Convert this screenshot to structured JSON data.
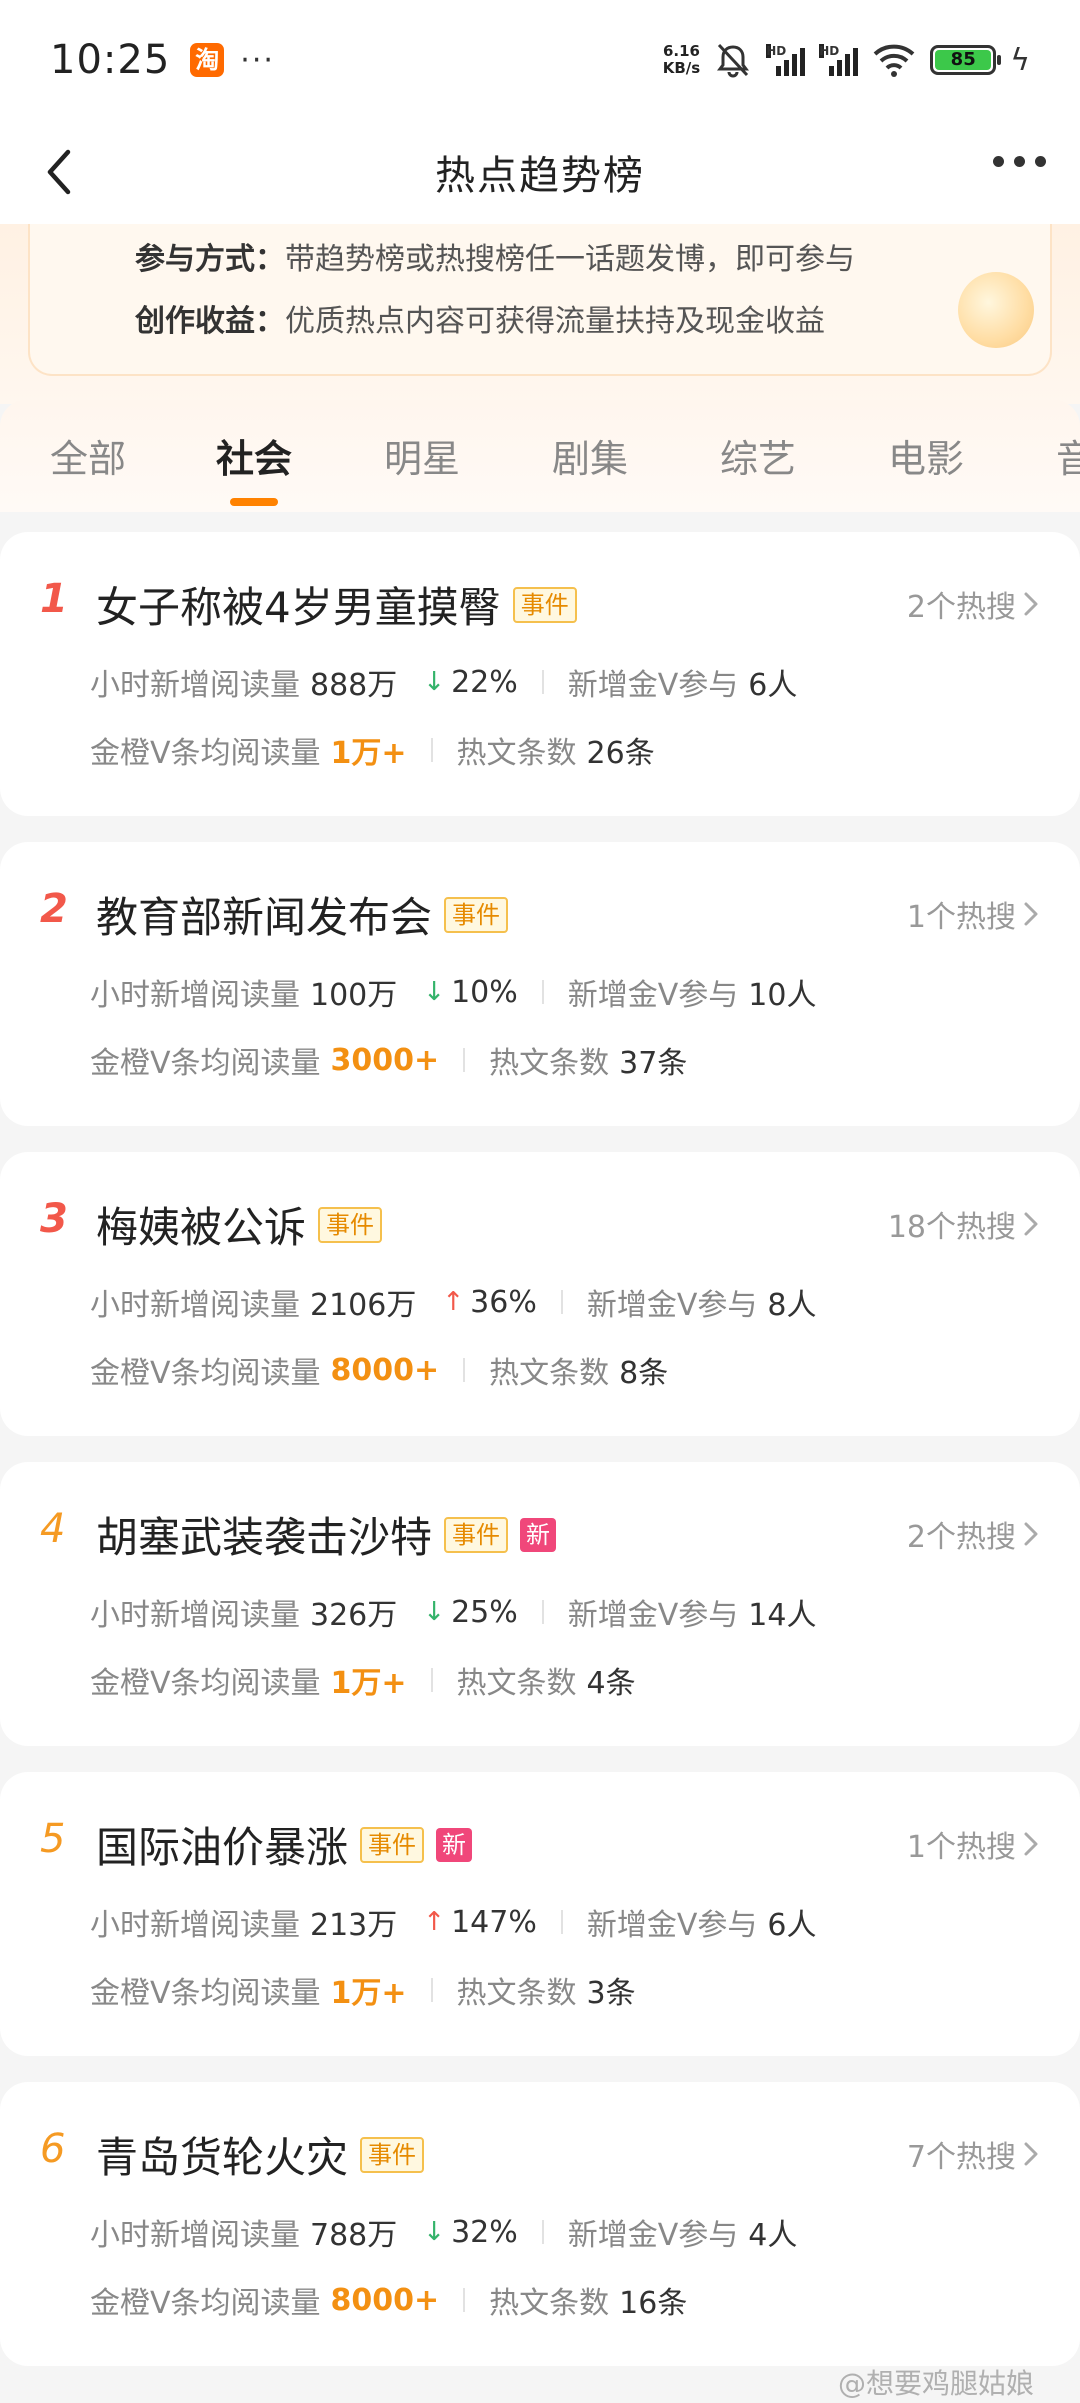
{
  "status_bar": {
    "time": "10:25",
    "app_icon_label": "淘",
    "dots": "···",
    "net_speed_top": "6.16",
    "net_speed_bottom": "KB/s",
    "battery": "85"
  },
  "nav": {
    "title": "热点趋势榜"
  },
  "banner": {
    "line1_key": "参与方式：",
    "line1_value": "带趋势榜或热搜榜任一话题发博，即可参与",
    "line2_key": "创作收益：",
    "line2_value": "优质热点内容可获得流量扶持及现金收益"
  },
  "tabs": [
    "全部",
    "社会",
    "明星",
    "剧集",
    "综艺",
    "电影",
    "音"
  ],
  "active_tab": "社会",
  "labels": {
    "hourly_reads": "小时新增阅读量",
    "new_vip": "新增金V参与",
    "avg_reads": "金橙V条均阅读量",
    "hot_posts": "热文条数",
    "event_tag": "事件",
    "new_tag": "新"
  },
  "items": [
    {
      "rank": "1",
      "title": "女子称被4岁男童摸臀",
      "is_new": false,
      "hot_count": "2个热搜",
      "hourly_reads": "888万",
      "trend": "down",
      "pct": "22%",
      "new_vip": "6人",
      "avg_reads": "1万+",
      "hot_posts": "26条"
    },
    {
      "rank": "2",
      "title": "教育部新闻发布会",
      "is_new": false,
      "hot_count": "1个热搜",
      "hourly_reads": "100万",
      "trend": "down",
      "pct": "10%",
      "new_vip": "10人",
      "avg_reads": "3000+",
      "hot_posts": "37条"
    },
    {
      "rank": "3",
      "title": "梅姨被公诉",
      "is_new": false,
      "hot_count": "18个热搜",
      "hourly_reads": "2106万",
      "trend": "up",
      "pct": "36%",
      "new_vip": "8人",
      "avg_reads": "8000+",
      "hot_posts": "8条"
    },
    {
      "rank": "4",
      "title": "胡塞武装袭击沙特",
      "is_new": true,
      "hot_count": "2个热搜",
      "hourly_reads": "326万",
      "trend": "down",
      "pct": "25%",
      "new_vip": "14人",
      "avg_reads": "1万+",
      "hot_posts": "4条"
    },
    {
      "rank": "5",
      "title": "国际油价暴涨",
      "is_new": true,
      "hot_count": "1个热搜",
      "hourly_reads": "213万",
      "trend": "up",
      "pct": "147%",
      "new_vip": "6人",
      "avg_reads": "1万+",
      "hot_posts": "3条"
    },
    {
      "rank": "6",
      "title": "青岛货轮火灾",
      "is_new": false,
      "hot_count": "7个热搜",
      "hourly_reads": "788万",
      "trend": "down",
      "pct": "32%",
      "new_vip": "4人",
      "avg_reads": "8000+",
      "hot_posts": "16条"
    }
  ],
  "watermark": "@想要鸡腿姑娘",
  "colors": {
    "accent": "#ff8200",
    "rank_top": "#f2584a",
    "rank_normal": "#f59a23",
    "up": "#f2584a",
    "down": "#34b36a"
  }
}
